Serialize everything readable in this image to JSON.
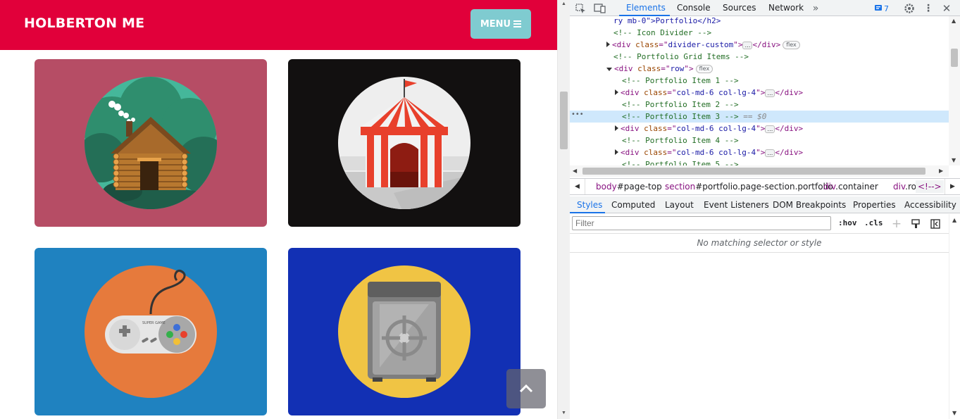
{
  "site": {
    "brand": "HOLBERTON ME",
    "menu_label": "MENU",
    "portfolio_colors": {
      "cabin": "#b64d65",
      "circus": "#121010",
      "game": "#1f82c0",
      "safe": "#1230b4"
    },
    "icons": [
      "cabin-icon",
      "circus-tent-icon",
      "game-controller-icon",
      "safe-icon",
      "chevron-up-icon"
    ],
    "controller_text": "SUPER GAME"
  },
  "devtools": {
    "tabs": [
      "Elements",
      "Console",
      "Sources",
      "Network"
    ],
    "active_tab": "Elements",
    "issues_count": "7",
    "dom": [
      {
        "kind": "partial",
        "text": "ry mb-0\">Portfolio</h2>"
      },
      {
        "kind": "comment",
        "text": "<!-- Icon Divider -->"
      },
      {
        "kind": "collapsed",
        "tag": "div",
        "attr": "class",
        "val": "divider-custom",
        "badge": "flex"
      },
      {
        "kind": "comment",
        "text": "<!-- Portfolio Grid Items -->"
      },
      {
        "kind": "open",
        "tag": "div",
        "attr": "class",
        "val": "row",
        "badge": "flex"
      },
      {
        "kind": "comment",
        "text": "<!-- Portfolio Item 1 -->"
      },
      {
        "kind": "collapsed",
        "tag": "div",
        "attr": "class",
        "val": "col-md-6 col-lg-4"
      },
      {
        "kind": "comment",
        "text": "<!-- Portfolio Item 2 -->"
      },
      {
        "kind": "selected",
        "text": "<!-- Portfolio Item 3 -->",
        "suffix": "== $0"
      },
      {
        "kind": "collapsed",
        "tag": "div",
        "attr": "class",
        "val": "col-md-6 col-lg-4"
      },
      {
        "kind": "comment",
        "text": "<!-- Portfolio Item 4 -->"
      },
      {
        "kind": "collapsed",
        "tag": "div",
        "attr": "class",
        "val": "col-md-6 col-lg-4"
      },
      {
        "kind": "comment",
        "text": "<!-- Portfolio Item 5 -->"
      }
    ],
    "ellipsis": "…",
    "breadcrumbs": [
      {
        "tag": "body",
        "rest": "#page-top"
      },
      {
        "tag": "section",
        "rest": "#portfolio.page-section.portfolio"
      },
      {
        "tag": "div",
        "rest": ".container"
      },
      {
        "tag": "div",
        "rest": ".row"
      },
      {
        "tag": "<!--",
        "rest": ">"
      }
    ],
    "styles_tabs": [
      "Styles",
      "Computed",
      "Layout",
      "Event Listeners",
      "DOM Breakpoints",
      "Properties",
      "Accessibility"
    ],
    "active_styles_tab": "Styles",
    "filter_placeholder": "Filter",
    "hov_label": ":hov",
    "cls_label": ".cls",
    "empty_message": "No matching selector or style"
  }
}
